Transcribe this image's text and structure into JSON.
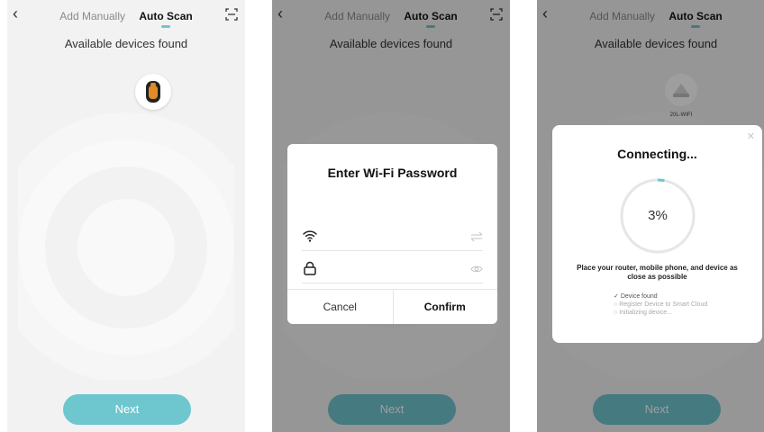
{
  "nav": {
    "add_manually": "Add Manually",
    "auto_scan": "Auto Scan"
  },
  "title": "Available devices found",
  "next_label": "Next",
  "wifi_dialog": {
    "title": "Enter Wi-Fi Password",
    "wifi_value": "",
    "password_value": "",
    "cancel": "Cancel",
    "confirm": "Confirm"
  },
  "device": {
    "label": "20L-WIFI"
  },
  "connecting": {
    "title": "Connecting...",
    "percent": "3%",
    "progress": 0.03,
    "hint": "Place your router, mobile phone, and device as close as possible",
    "steps": [
      {
        "text": "Device found",
        "status": "done",
        "marker": "✓"
      },
      {
        "text": "Register Device to Smart Cloud",
        "status": "pending",
        "marker": "○"
      },
      {
        "text": "Initializing device...",
        "status": "pending",
        "marker": "○"
      }
    ]
  },
  "colors": {
    "accent": "#6ec6cf",
    "button_disabled": "#2f8389"
  }
}
